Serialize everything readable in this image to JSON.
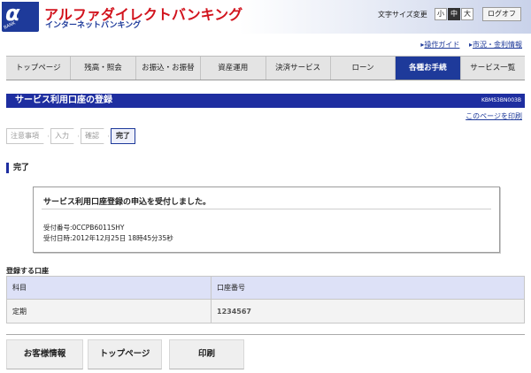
{
  "header": {
    "logo_mark": "α",
    "logo_small": "BANK",
    "brand": "アルファダイレクトバンキング",
    "brand_sub": "インターネットバンキング",
    "font_size_label": "文字サイズ変更",
    "font_sizes": [
      "小",
      "中",
      "大"
    ],
    "logoff": "ログオフ"
  },
  "sublinks": [
    "操作ガイド",
    "市況・金利情報"
  ],
  "nav": [
    "トップページ",
    "残高・照会",
    "お振込・お振替",
    "資産運用",
    "決済サービス",
    "ローン",
    "各種お手続",
    "サービス一覧"
  ],
  "page": {
    "title": "サービス利用口座の登録",
    "screen_id": "KBMS3BN003B",
    "print_link": "このページを印刷"
  },
  "steps": [
    "注意事項",
    "入力",
    "確認",
    "完了"
  ],
  "section_title": "完了",
  "message": {
    "heading": "サービス利用口座登録の申込を受付しました。",
    "receipt_number": "受付番号:0CCPB6011SHY",
    "receipt_datetime": "受付日時:2012年12月25日 18時45分35秒"
  },
  "accounts": {
    "caption": "登録する口座",
    "columns": [
      "科目",
      "口座番号"
    ],
    "rows": [
      [
        "定期",
        "1234567"
      ]
    ]
  },
  "buttons": [
    "お客様情報",
    "トップページ",
    "印刷"
  ],
  "colors": {
    "brand_red": "#d2141e",
    "brand_blue": "#1e3a9a",
    "nav_active": "#1e3a9a"
  }
}
